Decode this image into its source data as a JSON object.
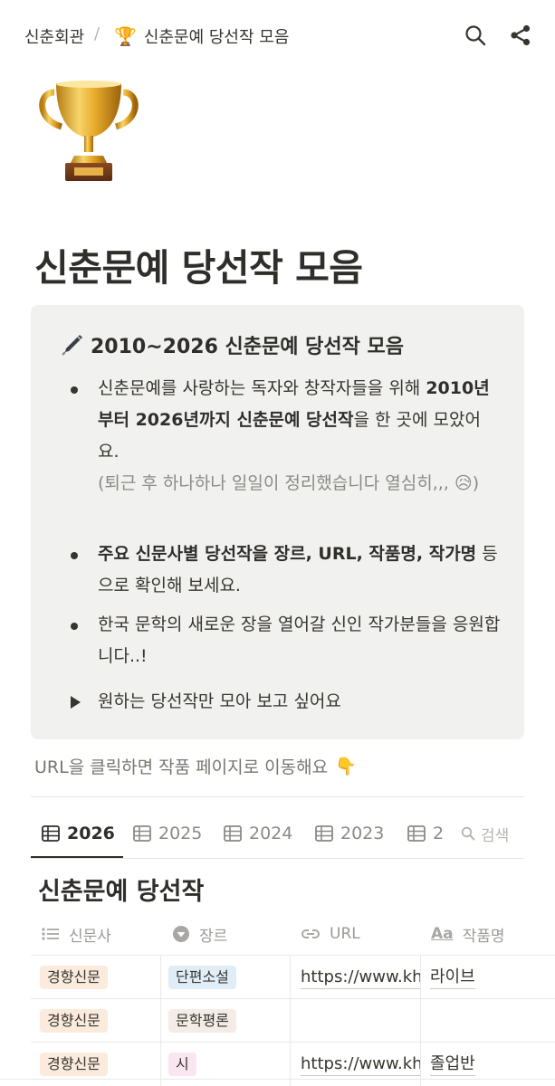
{
  "breadcrumb": {
    "root": "신춘회관",
    "separator": "/",
    "page_emoji": "🏆",
    "page_title": "신춘문예 당선작 모음"
  },
  "page": {
    "title": "신춘문예 당선작 모음"
  },
  "callout": {
    "heading": "2010~2026 신춘문예 당선작 모음",
    "bullets": [
      {
        "parts": [
          "신춘문예를 사랑하는 독자와 창작자들을 위해 ",
          "2010년부터 2026년까지 신춘문예 당선작",
          "을 한 곳에 모았어요."
        ],
        "note": "(퇴근 후 하나하나 일일이 정리했습니다 열심히,,,",
        "note_end": ")"
      },
      {
        "parts": [
          "주요 신문사별 당선작을 장르, URL, 작품명, 작가명",
          " 등으로 확인해 보세요."
        ]
      },
      {
        "text": "한국 문학의 새로운 장을 열어갈 신인 작가분들을 응원합니다..!"
      }
    ],
    "toggle": "원하는 당선작만 모아 보고 싶어요"
  },
  "hint": "URL을 클릭하면 작품 페이지로 이동해요",
  "tabs": [
    "2026",
    "2025",
    "2024",
    "2023",
    "2"
  ],
  "tab_search": "검색",
  "database": {
    "title": "신춘문예 당선작",
    "columns": [
      "신문사",
      "장르",
      "URL",
      "작품명"
    ],
    "rows": [
      {
        "newspaper": "경향신문",
        "genre": "단편소설",
        "genre_color": "#e0edf7",
        "url": "https://www.kh",
        "work": "라이브"
      },
      {
        "newspaper": "경향신문",
        "genre": "문학평론",
        "genre_color": "#f4ece7",
        "url": "",
        "work": ""
      },
      {
        "newspaper": "경향신문",
        "genre": "시",
        "genre_color": "#f9e6f1",
        "url": "https://www.kh",
        "work": "졸업반"
      }
    ]
  },
  "colors": {
    "newspaper_tag": "#faebdd",
    "text": "#37352f",
    "muted": "#8b8a86"
  }
}
